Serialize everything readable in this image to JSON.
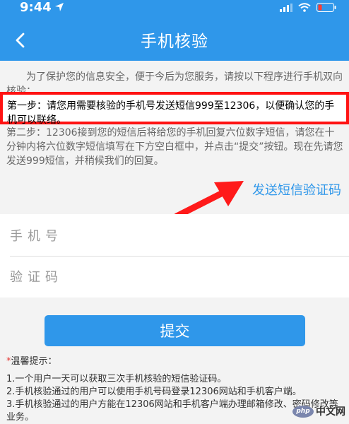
{
  "status": {
    "time": "9:44",
    "icons": [
      "signal-icon",
      "wifi-icon",
      "battery-icon"
    ],
    "battery_color": "#ff3b30"
  },
  "header": {
    "title": "手机核验",
    "back_icon": "chevron-left-icon",
    "background": "#2f97ea"
  },
  "intro": {
    "text": "为了保护您的信息安全，便于今后为您服务，请按以下程序进行手机双向核验："
  },
  "steps": {
    "step1": "第一步：请您用需要核验的手机号发送短信999至12306，以便确认您的手机可以联络。",
    "step2": "第二步：12306接到您的短信后将给您的手机回复六位数字短信，请您在十分钟内将六位数字短信填写在下方空白框中，并点击“提交”按钮。现在先请您发送999短信，并稍候我们的回复。"
  },
  "send_sms_link": "发送短信验证码",
  "form": {
    "phone_placeholder": "手机号",
    "code_placeholder": "验证码",
    "submit_label": "提交"
  },
  "tips": {
    "title": "温馨提示：",
    "items": [
      "1.一个用户一天可以获取三次手机核验的短信验证码。",
      "2.手机核验通过的用户可以使用手机号码登录12306网站和手机客户端。",
      "3.手机核验通过的用户方能在12306网站和手机客户端办理邮箱修改、密码修改等业务。"
    ]
  },
  "watermark": {
    "logo": "php",
    "text": "中文网"
  },
  "colors": {
    "accent": "#2f97ea",
    "highlight_border": "#ff1212",
    "annotation_arrow": "#ff1a1a"
  }
}
